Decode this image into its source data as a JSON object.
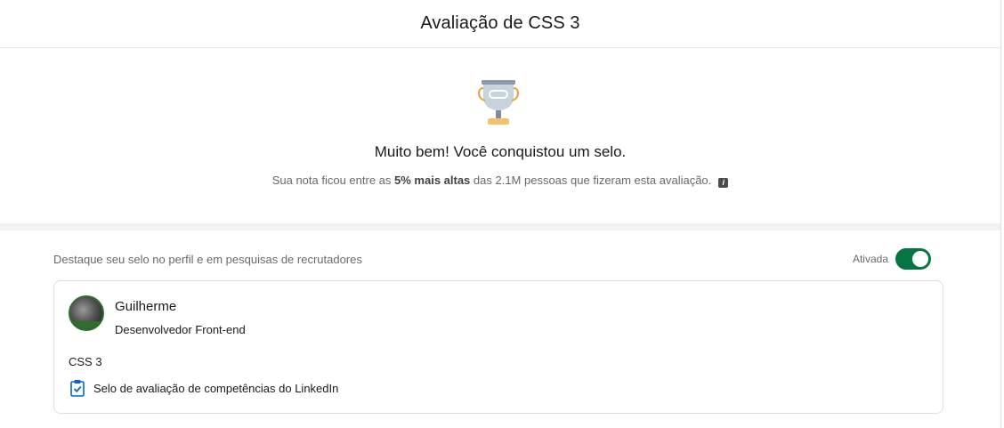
{
  "header": {
    "title": "Avaliação de CSS 3"
  },
  "hero": {
    "heading": "Muito bem! Você conquistou um selo.",
    "note_prefix": "Sua nota ficou entre as ",
    "note_highlight": "5% mais altas",
    "note_suffix": " das 2.1M pessoas que fizeram esta avaliação.",
    "icon": "trophy-icon"
  },
  "feature": {
    "label": "Destaque seu selo no perfil e em pesquisas de recrutadores",
    "toggle_state": "Ativada",
    "toggle_on": true,
    "toggle_color": "#057642"
  },
  "card": {
    "name": "Guilherme",
    "headline": "Desenvolvedor Front-end",
    "skill": "CSS 3",
    "badge_text": "Selo de avaliação de competências do LinkedIn",
    "badge_icon": "clipboard-check-icon"
  }
}
